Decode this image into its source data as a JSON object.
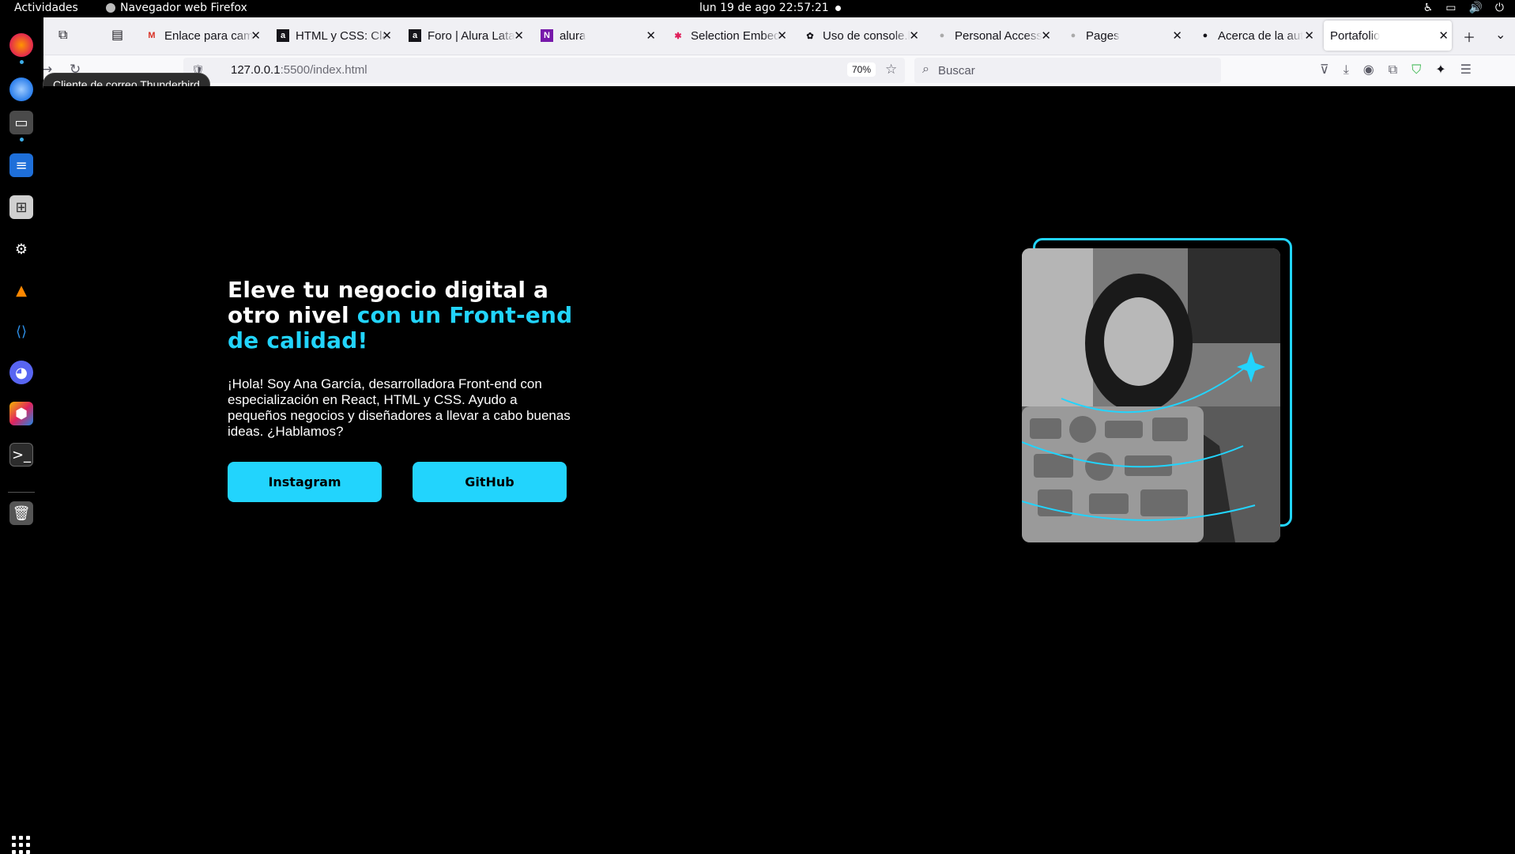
{
  "system_bar": {
    "activities": "Actividades",
    "app_name": "Navegador web Firefox",
    "clock": "lun 19 de ago  22:57:21"
  },
  "tabs": [
    {
      "title": "Enlace para cam",
      "icon": "gmail-icon"
    },
    {
      "title": "HTML y CSS: Cla",
      "icon": "alura-icon"
    },
    {
      "title": "Foro | Alura Lata",
      "icon": "alura-icon"
    },
    {
      "title": "alura",
      "icon": "onenote-icon"
    },
    {
      "title": "Selection Embed",
      "icon": "slack-icon"
    },
    {
      "title": "Uso de console.l",
      "icon": "openai-icon"
    },
    {
      "title": "Personal Access",
      "icon": "github-icon"
    },
    {
      "title": "Pages",
      "icon": "github-icon"
    },
    {
      "title": "Acerca de la aut",
      "icon": "github-icon"
    },
    {
      "title": "Portafolio",
      "icon": "none",
      "active": true
    }
  ],
  "navbar": {
    "url_host": "127.0.0.1",
    "url_path": ":5500/index.html",
    "zoom": "70%",
    "search_placeholder": "Buscar"
  },
  "dock": {
    "tooltip": "Cliente de correo Thunderbird"
  },
  "hero": {
    "title_plain": "Eleve tu negocio digital a otro nivel ",
    "title_accent": "con un Front-end de calidad!",
    "description": "¡Hola! Soy Ana García, desarrolladora Front-end con especialización en React, HTML y CSS. Ayudo a pequeños negocios y diseñadores a llevar a cabo buenas ideas. ¿Hablamos?",
    "buttons": {
      "instagram": "Instagram",
      "github": "GitHub"
    }
  },
  "colors": {
    "accent": "#22d4fd",
    "background": "#000000"
  }
}
